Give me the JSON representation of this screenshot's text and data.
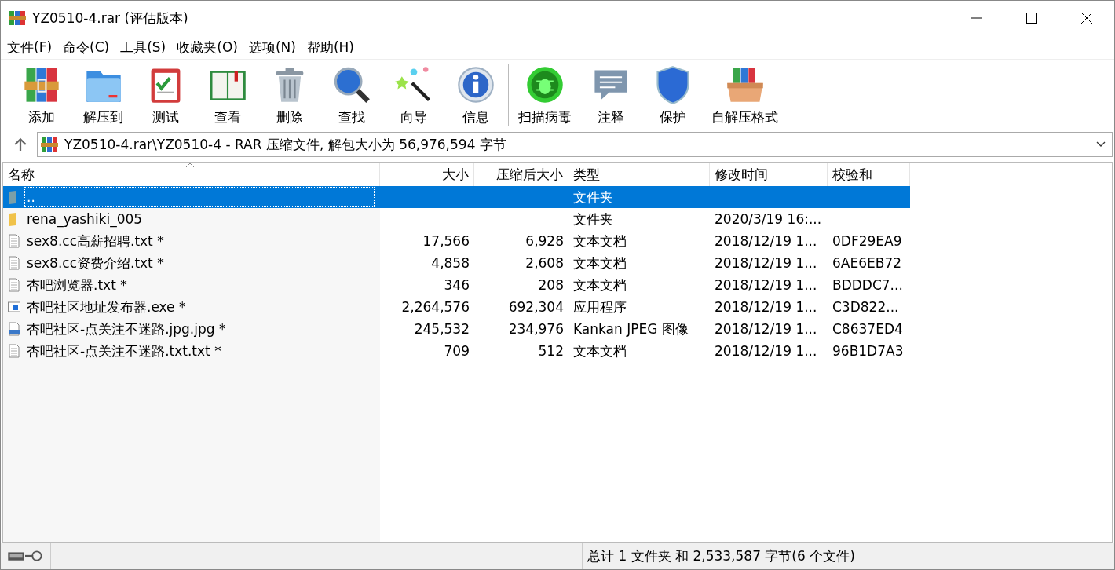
{
  "window": {
    "title": "YZ0510-4.rar (评估版本)"
  },
  "menu": [
    "文件(F)",
    "命令(C)",
    "工具(S)",
    "收藏夹(O)",
    "选项(N)",
    "帮助(H)"
  ],
  "toolbar": [
    [
      {
        "label": "添加",
        "kind": "add"
      },
      {
        "label": "解压到",
        "kind": "extract"
      },
      {
        "label": "测试",
        "kind": "test"
      },
      {
        "label": "查看",
        "kind": "view"
      },
      {
        "label": "删除",
        "kind": "delete"
      },
      {
        "label": "查找",
        "kind": "find"
      },
      {
        "label": "向导",
        "kind": "wizard"
      },
      {
        "label": "信息",
        "kind": "info"
      }
    ],
    [
      {
        "label": "扫描病毒",
        "kind": "scan"
      },
      {
        "label": "注释",
        "kind": "comment"
      },
      {
        "label": "保护",
        "kind": "protect"
      },
      {
        "label": "自解压格式",
        "kind": "sfx"
      }
    ]
  ],
  "address": {
    "path": "YZ0510-4.rar\\YZ0510-4 - RAR 压缩文件, 解包大小为 56,976,594 字节"
  },
  "table": {
    "columns": [
      "名称",
      "大小",
      "压缩后大小",
      "类型",
      "修改时间",
      "校验和"
    ],
    "rows": [
      {
        "kind": "up",
        "name": "..",
        "size": "",
        "packed": "",
        "type": "文件夹",
        "modified": "",
        "crc": "",
        "selected": true
      },
      {
        "kind": "folder",
        "name": "rena_yashiki_005",
        "size": "",
        "packed": "",
        "type": "文件夹",
        "modified": "2020/3/19 16:...",
        "crc": "",
        "selected": false
      },
      {
        "kind": "text",
        "name": "sex8.cc高薪招聘.txt *",
        "size": "17,566",
        "packed": "6,928",
        "type": "文本文档",
        "modified": "2018/12/19 1...",
        "crc": "0DF29EA9",
        "selected": false
      },
      {
        "kind": "text",
        "name": "sex8.cc资费介绍.txt *",
        "size": "4,858",
        "packed": "2,608",
        "type": "文本文档",
        "modified": "2018/12/19 1...",
        "crc": "6AE6EB72",
        "selected": false
      },
      {
        "kind": "text",
        "name": "杏吧浏览器.txt *",
        "size": "346",
        "packed": "208",
        "type": "文本文档",
        "modified": "2018/12/19 1...",
        "crc": "BDDDC7...",
        "selected": false
      },
      {
        "kind": "exe",
        "name": "杏吧社区地址发布器.exe *",
        "size": "2,264,576",
        "packed": "692,304",
        "type": "应用程序",
        "modified": "2018/12/19 1...",
        "crc": "C3D822...",
        "selected": false
      },
      {
        "kind": "jpg",
        "name": "杏吧社区-点关注不迷路.jpg.jpg *",
        "size": "245,532",
        "packed": "234,976",
        "type": "Kankan JPEG 图像",
        "modified": "2018/12/19 1...",
        "crc": "C8637ED4",
        "selected": false
      },
      {
        "kind": "text",
        "name": "杏吧社区-点关注不迷路.txt.txt *",
        "size": "709",
        "packed": "512",
        "type": "文本文档",
        "modified": "2018/12/19 1...",
        "crc": "96B1D7A3",
        "selected": false
      }
    ]
  },
  "status_bar": {
    "summary": "总计 1 文件夹 和 2,533,587 字节(6 个文件)"
  }
}
